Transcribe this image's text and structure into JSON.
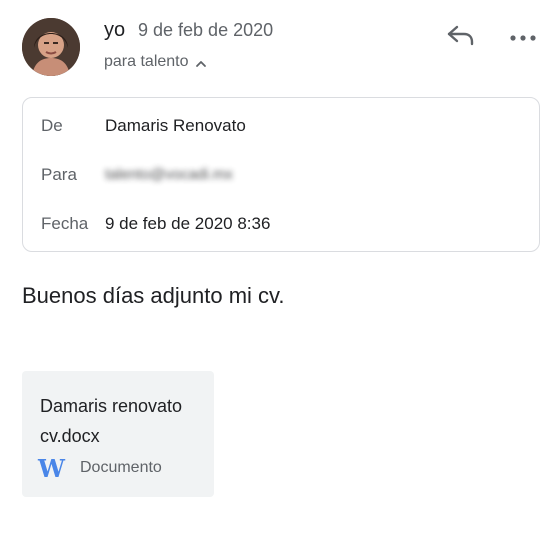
{
  "header": {
    "sender": "yo",
    "date": "9 de feb de 2020",
    "recipient_summary": "para talento"
  },
  "details": {
    "from_label": "De",
    "from_value": "Damaris Renovato",
    "to_label": "Para",
    "to_value": "talento@vocadi.mx",
    "date_label": "Fecha",
    "date_value": "9 de feb de 2020 8:36"
  },
  "message": {
    "body": "Buenos días adjunto mi cv."
  },
  "attachment": {
    "name_line1": "Damaris renovato",
    "name_line2": "cv.docx",
    "type_label": "Documento",
    "icon": "word-document-icon",
    "icon_letter": "W",
    "icon_color": "#4a86e8"
  },
  "icons": {
    "reply": "reply-icon",
    "more": "more-options-icon",
    "expand": "chevron-up-icon"
  }
}
